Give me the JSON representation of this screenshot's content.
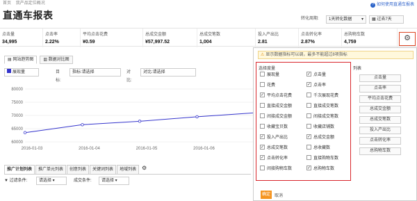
{
  "breadcrumb": [
    "首页",
    "我产品定位概况"
  ],
  "page_title": "直通车报表",
  "help_link": "如何使用直通车报表",
  "top_controls": {
    "conversion_label": "转化周期:",
    "conversion_value": "1天转化数据",
    "period": "过去7天"
  },
  "metrics": [
    {
      "label": "点击量",
      "value": "34,995"
    },
    {
      "label": "点击率",
      "value": "2.22%"
    },
    {
      "label": "平均点击花费",
      "value": "¥0.59"
    },
    {
      "label": "总成交金额",
      "value": "¥57,997.52"
    },
    {
      "label": "总成交笔数",
      "value": "1,004"
    },
    {
      "label": "投入产出比",
      "value": "2.81"
    },
    {
      "label": "点击转化率",
      "value": "2.87%"
    },
    {
      "label": "总购物车数",
      "value": "4,759"
    }
  ],
  "chart_tabs": [
    "网站趋势图",
    "数据对比图"
  ],
  "chart_filters": {
    "metric": "展现量",
    "target_label": "目标:",
    "target": "指标:请选择",
    "compare_label": "对比:",
    "compare": "对比:请选择"
  },
  "chart_data": {
    "type": "line",
    "x": [
      "2016-01-03",
      "2016-01-04",
      "2016-01-05",
      "2016-01-06",
      "2016-01-07"
    ],
    "y": [
      63500,
      66500,
      67800,
      69500,
      71000
    ],
    "ylim": [
      60000,
      80000
    ],
    "yticks": [
      60000,
      65000,
      70000,
      75000,
      80000
    ],
    "xticklabels": [
      "2016-01-03",
      "2016-01-04",
      "2016-01-05",
      "2016-01-06"
    ],
    "color": "#3333cc"
  },
  "bottom_tabs": [
    "推广计划列表",
    "推广单元列表",
    "创意列表",
    "关键词列表",
    "地域列表"
  ],
  "bottom_filters": {
    "filter1_label": "过滤条件:",
    "filter1": "请选择",
    "filter2_label": "成交条件:",
    "filter2": "请选择"
  },
  "dialog": {
    "hint": "显示数据指标可以调，最多不能超过8项指标",
    "group_title": "选择度量",
    "list_tag": "列表",
    "fields": [
      {
        "label": "展现量",
        "checked": false
      },
      {
        "label": "点击量",
        "checked": true
      },
      {
        "label": "花费",
        "checked": false
      },
      {
        "label": "点击率",
        "checked": true
      },
      {
        "label": "平均点击花费",
        "checked": true
      },
      {
        "label": "千次展现花费",
        "checked": false
      },
      {
        "label": "直接成交金额",
        "checked": false
      },
      {
        "label": "直接成交笔数",
        "checked": false
      },
      {
        "label": "间接成交金额",
        "checked": false
      },
      {
        "label": "间接成交笔数",
        "checked": false
      },
      {
        "label": "收藏宝贝数",
        "checked": false
      },
      {
        "label": "收藏店铺数",
        "checked": false
      },
      {
        "label": "投入产出比",
        "checked": true
      },
      {
        "label": "总成交金额",
        "checked": true
      },
      {
        "label": "总成交笔数",
        "checked": true
      },
      {
        "label": "总收藏数",
        "checked": false
      },
      {
        "label": "点击转化率",
        "checked": true
      },
      {
        "label": "直接购物车数",
        "checked": false
      },
      {
        "label": "间接购物车数",
        "checked": false
      },
      {
        "label": "总购物车数",
        "checked": true
      }
    ],
    "selected": [
      "点击量",
      "点击率",
      "平均点击花费",
      "总成交金额",
      "总成交笔数",
      "投入产出比",
      "点击转化率",
      "总购物车数"
    ],
    "ok_label": "确定",
    "cancel_label": "取消"
  }
}
